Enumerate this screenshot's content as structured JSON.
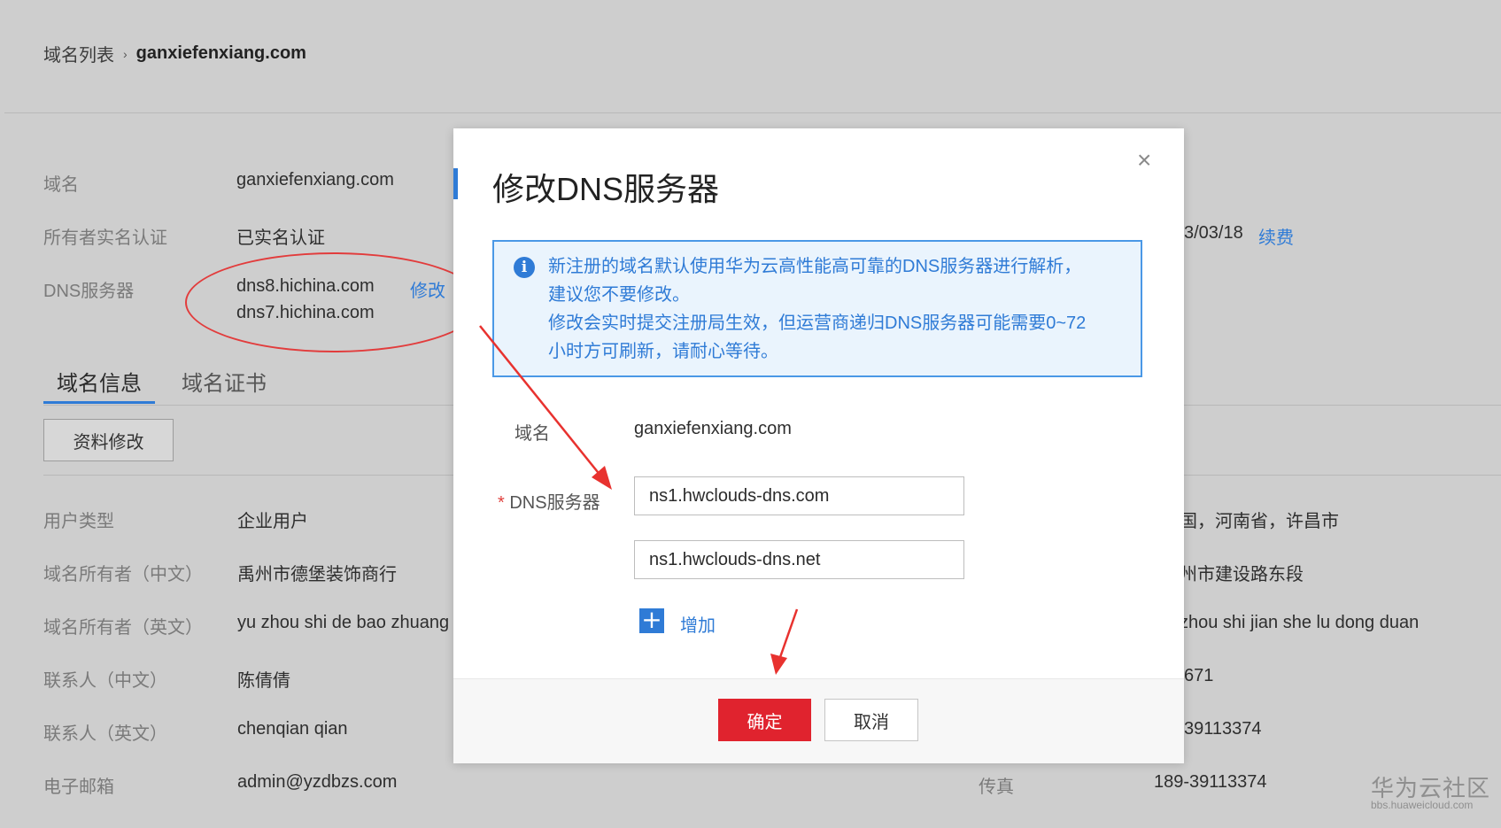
{
  "breadcrumb": {
    "parent": "域名列表",
    "separator": "›",
    "current": "ganxiefenxiang.com"
  },
  "summary": {
    "domain_label": "域名",
    "domain_value": "ganxiefenxiang.com",
    "owner_auth_label": "所有者实名认证",
    "owner_auth_value": "已实名认证",
    "dns_label": "DNS服务器",
    "dns1": "dns8.hichina.com",
    "dns2": "dns7.hichina.com",
    "dns_edit": "修改",
    "expiry_partial": "3/03/18",
    "renew": "续费"
  },
  "tabs": [
    {
      "label": "域名信息"
    },
    {
      "label": "域名证书"
    }
  ],
  "edit_info_button": "资料修改",
  "details": {
    "user_type_label": "用户类型",
    "user_type_value": "企业用户",
    "owner_cn_label": "域名所有者（中文）",
    "owner_cn_value": "禹州市德堡装饰商行",
    "owner_en_label": "域名所有者（英文）",
    "owner_en_value": "yu zhou shi de bao zhuang",
    "contact_cn_label": "联系人（中文）",
    "contact_cn_value": "陈倩倩",
    "contact_en_label": "联系人（英文）",
    "contact_en_value": "chenqian qian",
    "email_label": "电子邮箱",
    "email_value": "admin@yzdbzs.com",
    "fax_label": "传真",
    "fax_value": "189-39113374",
    "right_region": "国，河南省，许昌市",
    "right_addr_cn": "州市建设路东段",
    "right_addr_en": "zhou shi jian she lu dong duan",
    "right_phone1": "671",
    "right_phone2": "39113374"
  },
  "modal": {
    "title": "修改DNS服务器",
    "close": "×",
    "info_icon": "i",
    "info_line1": "新注册的域名默认使用华为云高性能高可靠的DNS服务器进行解析，",
    "info_line2": "建议您不要修改。",
    "info_line3": "修改会实时提交注册局生效，但运营商递归DNS服务器可能需要0~72",
    "info_line4": "小时方可刷新，请耐心等待。",
    "domain_label": "域名",
    "domain_value": "ganxiefenxiang.com",
    "required_mark": "*",
    "dns_label": "DNS服务器",
    "dns_input1": "ns1.hwclouds-dns.com",
    "dns_input2": "ns1.hwclouds-dns.net",
    "add_icon": "+",
    "add_label": "增加",
    "ok": "确定",
    "cancel": "取消"
  },
  "watermark": {
    "line1": "华为云社区",
    "line2": "bbs.huaweicloud.com"
  },
  "colors": {
    "accent": "#2f7bd6",
    "danger": "#e0232e",
    "annotation": "#e23c3c"
  }
}
